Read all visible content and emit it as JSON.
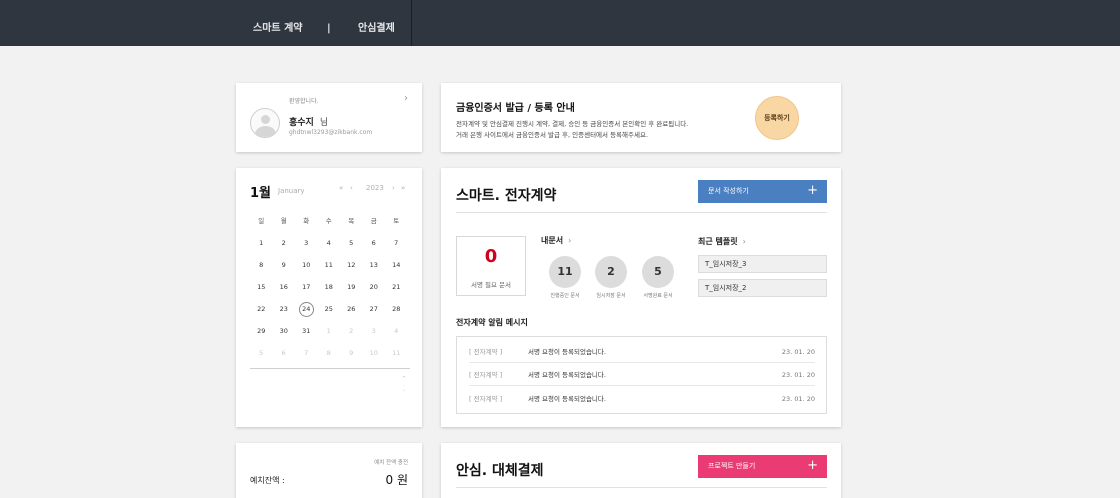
{
  "nav": {
    "item1": "스마트 계약",
    "divider": "|",
    "item2": "안심결제"
  },
  "profile": {
    "welcome": "환영합니다.",
    "name": "홍수지",
    "suffix": "님",
    "email": "ghdtnwl3293@zikbank.com",
    "chevron": "›"
  },
  "notice": {
    "title": "금융인증서 발급 / 등록 안내",
    "line1": "전자계약 및 안심결제 진행시 계약, 결제, 승인 등 금융인증서 본인확인 후 완료됩니다.",
    "line2": "거래 은행 사이트에서 금융인증서 발급 후, 인증센터에서 등록해주세요.",
    "button": "등록하기"
  },
  "calendar": {
    "month": "1월",
    "month_en": "January",
    "year": "2023",
    "prev_year": "«",
    "prev": "‹",
    "next": "›",
    "next_year": "»",
    "weekdays": [
      "일",
      "월",
      "화",
      "수",
      "목",
      "금",
      "토"
    ],
    "weeks": [
      [
        "1",
        "2",
        "3",
        "4",
        "5",
        "6",
        "7"
      ],
      [
        "8",
        "9",
        "10",
        "11",
        "12",
        "13",
        "14"
      ],
      [
        "15",
        "16",
        "17",
        "18",
        "19",
        "20",
        "21"
      ],
      [
        "22",
        "23",
        "24",
        "25",
        "26",
        "27",
        "28"
      ],
      [
        "29",
        "30",
        "31",
        "1",
        "2",
        "3",
        "4"
      ],
      [
        "5",
        "6",
        "7",
        "8",
        "9",
        "10",
        "11"
      ]
    ],
    "today": "24",
    "scroll_glyphs": [
      "^",
      "·",
      "˅"
    ]
  },
  "contract": {
    "title": "스마트. 전자계약",
    "button": "문서 작성하기",
    "plus": "+",
    "sign_count": "0",
    "sign_label": "서명 필요 문서",
    "my_docs": "내문서",
    "recent_tpl": "최근 템플릿",
    "chevron": "›",
    "stats": [
      {
        "value": "11",
        "label": "진행중인 문서"
      },
      {
        "value": "2",
        "label": "임시저장 문서"
      },
      {
        "value": "5",
        "label": "서명완료 문서"
      }
    ],
    "templates": [
      "T_임시저장_3",
      "T_임시저장_2"
    ],
    "msg_title": "전자계약 알림 메시지",
    "messages": [
      {
        "cat": "[ 전자계약 ]",
        "text": "서명 요청이 등록되었습니다.",
        "date": "23. 01. 20"
      },
      {
        "cat": "[ 전자계약 ]",
        "text": "서명 요청이 등록되었습니다.",
        "date": "23. 01. 20"
      },
      {
        "cat": "[ 전자계약 ]",
        "text": "서명 요청이 등록되었습니다.",
        "date": "23. 01. 20"
      }
    ]
  },
  "balance": {
    "hint": "예치 잔액 충전",
    "label": "예치잔액 :",
    "value": "0 원"
  },
  "payment": {
    "title": "안심. 대체결제",
    "button": "프로젝트 만들기",
    "plus": "+"
  },
  "colors": {
    "nav_bg": "#2f3640",
    "blue": "#4a7fc1",
    "pink": "#eb3b74",
    "red": "#d0021b",
    "peach": "#f8d7a4"
  }
}
